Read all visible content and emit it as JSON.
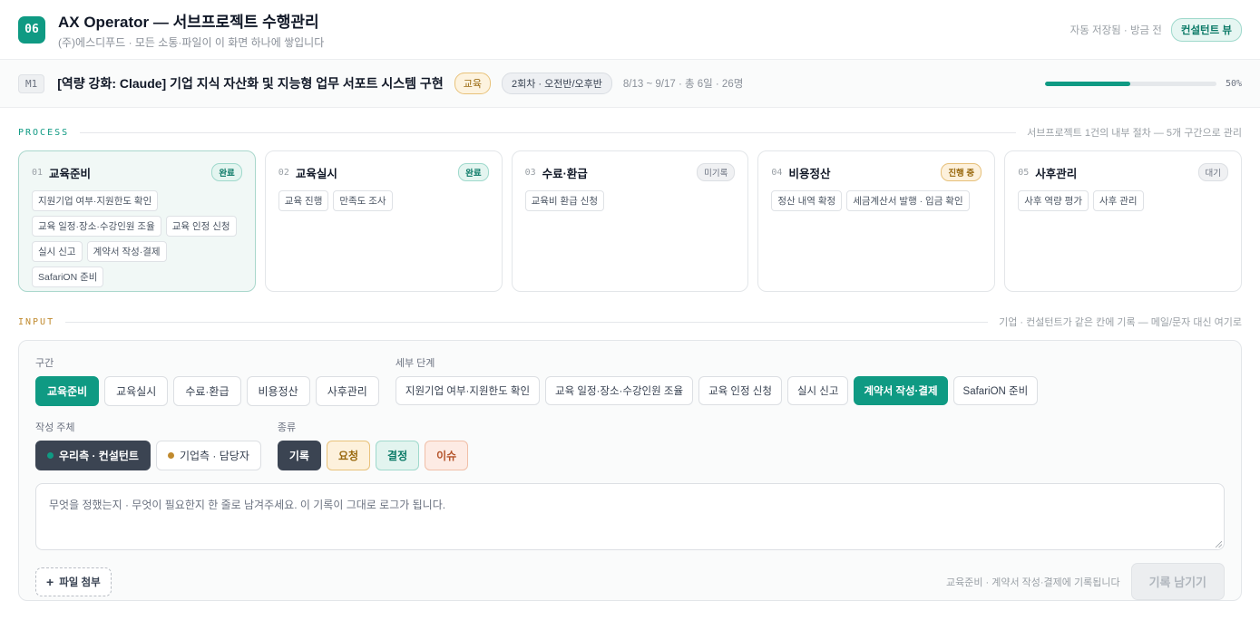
{
  "header": {
    "logo_text": "06",
    "title": "AX Operator — 서브프로젝트 수행관리",
    "subtitle": "(주)에스디푸드 · 모든 소통·파일이 이 화면 하나에 쌓입니다",
    "save_status": "자동 저장됨 · 방금 전",
    "view_badge": "컨설턴트 뷰"
  },
  "module": {
    "code": "M1",
    "title": "[역량 강화: Claude] 기업 지식 자산화 및 지능형 업무 서포트 시스템 구현",
    "tag_category": "교육",
    "tag_round": "2회차 · 오전반/오후반",
    "meta": "8/13 ~ 9/17 · 총 6일 · 26명",
    "progress_percent": 50,
    "progress_text": "50%"
  },
  "process": {
    "label": "PROCESS",
    "note": "서브프로젝트 1건의 내부 절차 — 5개 구간으로 관리",
    "stages": [
      {
        "num": "01",
        "name": "교육준비",
        "status": "완료",
        "items": [
          "지원기업 여부·지원한도 확인",
          "교육 일정·장소·수강인원 조율",
          "교육 인정 신청",
          "실시 신고",
          "계약서 작성·결제",
          "SafariON 준비"
        ]
      },
      {
        "num": "02",
        "name": "교육실시",
        "status": "완료",
        "items": [
          "교육 진행",
          "만족도 조사"
        ]
      },
      {
        "num": "03",
        "name": "수료·환급",
        "status": "미기록",
        "items": [
          "교육비 환급 신청"
        ]
      },
      {
        "num": "04",
        "name": "비용정산",
        "status": "진행 중",
        "items": [
          "정산 내역 확정",
          "세금계산서 발행 · 입금 확인"
        ]
      },
      {
        "num": "05",
        "name": "사후관리",
        "status": "대기",
        "items": [
          "사후 역량 평가",
          "사후 관리"
        ]
      }
    ]
  },
  "input": {
    "label": "INPUT",
    "note": "기업 · 컨설턴트가 같은 칸에 기록 — 메일/문자 대신 여기로",
    "section_label": "구간",
    "sections": [
      "교육준비",
      "교육실시",
      "수료·환급",
      "비용정산",
      "사후관리"
    ],
    "detail_label": "세부 단계",
    "details": [
      "지원기업 여부·지원한도 확인",
      "교육 일정·장소·수강인원 조율",
      "교육 인정 신청",
      "실시 신고",
      "계약서 작성·결제",
      "SafariON 준비"
    ],
    "author_label": "작성 주체",
    "authors": [
      "우리측 · 컨설턴트",
      "기업측 · 담당자"
    ],
    "type_label": "종류",
    "types": [
      "기록",
      "요청",
      "결정",
      "이슈"
    ],
    "placeholder": "무엇을 정했는지 · 무엇이 필요한지 한 줄로 남겨주세요. 이 기록이 그대로 로그가 됩니다.",
    "attach_label": "파일 첨부",
    "target_text": "교육준비 · 계약서 작성·결제에 기록됩니다",
    "submit_label": "기록 남기기"
  },
  "colors": {
    "accent": "#0f9a83",
    "dark": "#3b4452",
    "consultant_dot": "#0f9a83",
    "company_dot": "#c08a2e"
  }
}
